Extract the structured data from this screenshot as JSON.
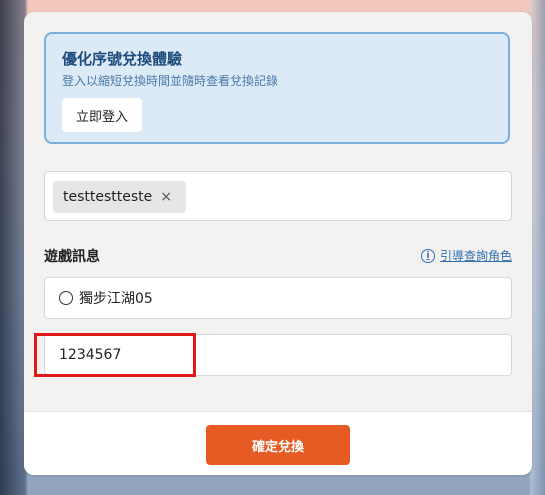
{
  "login_prompt": {
    "title": "優化序號兌換體驗",
    "subtitle": "登入以縮短兌換時間並隨時查看兌換記錄",
    "login_button": "立即登入"
  },
  "code_input": {
    "tag_value": "testtestteste",
    "remove_symbol": "×"
  },
  "game_info": {
    "title": "遊戲訊息",
    "guide_icon": "i",
    "guide_link": "引導查詢角色",
    "server_value": "獨步江湖05",
    "character_id_value": "1234567"
  },
  "footer": {
    "confirm_button": "確定兌換"
  },
  "colors": {
    "accent": "#e65b24",
    "link": "#2f6fb0",
    "highlight": "#e01818"
  }
}
